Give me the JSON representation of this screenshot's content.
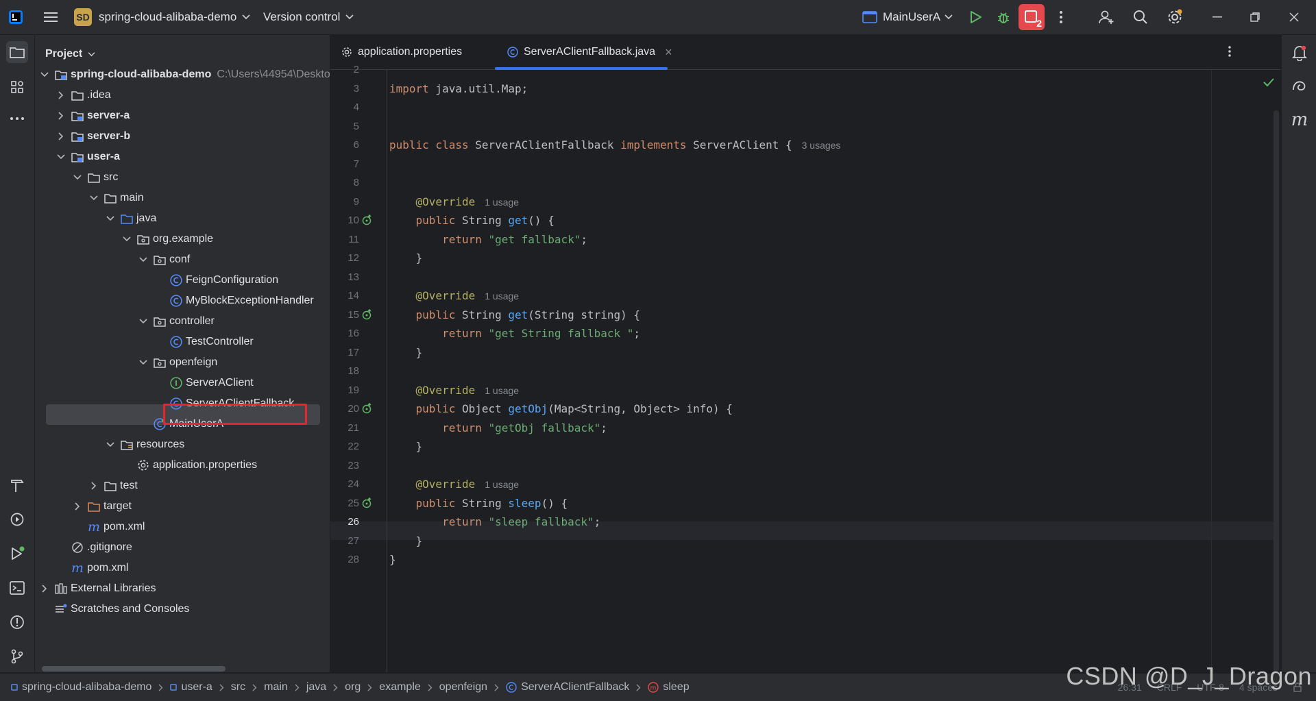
{
  "titlebar": {
    "project_badge": "SD",
    "project_name": "spring-cloud-alibaba-demo",
    "version_control": "Version control",
    "run_config": "MainUserA",
    "stop_badge": "2"
  },
  "project_panel": {
    "title": "Project",
    "root_path": "C:\\Users\\44954\\Deskto"
  },
  "tree": [
    {
      "label": "spring-cloud-alibaba-demo",
      "depth": 0,
      "arrow": "down",
      "icon": "module-folder",
      "bold": true
    },
    {
      "label": ".idea",
      "depth": 1,
      "arrow": "right",
      "icon": "folder"
    },
    {
      "label": "server-a",
      "depth": 1,
      "arrow": "right",
      "icon": "module-folder",
      "bold": true
    },
    {
      "label": "server-b",
      "depth": 1,
      "arrow": "right",
      "icon": "module-folder",
      "bold": true
    },
    {
      "label": "user-a",
      "depth": 1,
      "arrow": "down",
      "icon": "module-folder",
      "bold": true
    },
    {
      "label": "src",
      "depth": 2,
      "arrow": "down",
      "icon": "folder"
    },
    {
      "label": "main",
      "depth": 3,
      "arrow": "down",
      "icon": "folder"
    },
    {
      "label": "java",
      "depth": 4,
      "arrow": "down",
      "icon": "source-folder"
    },
    {
      "label": "org.example",
      "depth": 5,
      "arrow": "down",
      "icon": "package"
    },
    {
      "label": "conf",
      "depth": 6,
      "arrow": "down",
      "icon": "package"
    },
    {
      "label": "FeignConfiguration",
      "depth": 7,
      "arrow": "none",
      "icon": "class"
    },
    {
      "label": "MyBlockExceptionHandler",
      "depth": 7,
      "arrow": "none",
      "icon": "class"
    },
    {
      "label": "controller",
      "depth": 6,
      "arrow": "down",
      "icon": "package"
    },
    {
      "label": "TestController",
      "depth": 7,
      "arrow": "none",
      "icon": "class"
    },
    {
      "label": "openfeign",
      "depth": 6,
      "arrow": "down",
      "icon": "package"
    },
    {
      "label": "ServerAClient",
      "depth": 7,
      "arrow": "none",
      "icon": "interface"
    },
    {
      "label": "ServerAClientFallback",
      "depth": 7,
      "arrow": "none",
      "icon": "class"
    },
    {
      "label": "MainUserA",
      "depth": 6,
      "arrow": "none",
      "icon": "class-runnable"
    },
    {
      "label": "resources",
      "depth": 4,
      "arrow": "down",
      "icon": "resources-folder"
    },
    {
      "label": "application.properties",
      "depth": 5,
      "arrow": "none",
      "icon": "properties"
    },
    {
      "label": "test",
      "depth": 3,
      "arrow": "right",
      "icon": "folder"
    },
    {
      "label": "target",
      "depth": 2,
      "arrow": "right",
      "icon": "excluded-folder"
    },
    {
      "label": "pom.xml",
      "depth": 2,
      "arrow": "none",
      "icon": "maven"
    },
    {
      "label": ".gitignore",
      "depth": 1,
      "arrow": "none",
      "icon": "ignored"
    },
    {
      "label": "pom.xml",
      "depth": 1,
      "arrow": "none",
      "icon": "maven"
    },
    {
      "label": "External Libraries",
      "depth": 0,
      "arrow": "right",
      "icon": "libraries"
    },
    {
      "label": "Scratches and Consoles",
      "depth": 0,
      "arrow": "none",
      "icon": "scratches"
    }
  ],
  "tabs": [
    {
      "label": "application.properties",
      "icon": "gear-icon",
      "active": false
    },
    {
      "label": "ServerAClientFallback.java",
      "icon": "class-icon",
      "active": true,
      "close": "×"
    }
  ],
  "code_lines": [
    {
      "n": "2",
      "parts": []
    },
    {
      "n": "3",
      "parts": [
        {
          "t": "import",
          "c": "kw"
        },
        {
          "t": " java.util.Map;",
          "c": ""
        }
      ]
    },
    {
      "n": "4",
      "parts": []
    },
    {
      "n": "5",
      "parts": []
    },
    {
      "n": "6",
      "parts": [
        {
          "t": "public class",
          "c": "kw"
        },
        {
          "t": " ServerAClientFallback ",
          "c": ""
        },
        {
          "t": "implements",
          "c": "kw"
        },
        {
          "t": " ServerAClient {",
          "c": ""
        }
      ],
      "hint": "3 usages"
    },
    {
      "n": "7",
      "parts": []
    },
    {
      "n": "8",
      "parts": []
    },
    {
      "n": "9",
      "parts": [
        {
          "t": "    @Override",
          "c": "ann"
        }
      ],
      "hint": "1 usage"
    },
    {
      "n": "10",
      "parts": [
        {
          "t": "    public",
          "c": "kw"
        },
        {
          "t": " String ",
          "c": ""
        },
        {
          "t": "get",
          "c": "fn"
        },
        {
          "t": "() {",
          "c": ""
        }
      ],
      "gutter_icon": true
    },
    {
      "n": "11",
      "parts": [
        {
          "t": "        return",
          "c": "kw"
        },
        {
          "t": " ",
          "c": ""
        },
        {
          "t": "\"get fallback\"",
          "c": "str"
        },
        {
          "t": ";",
          "c": ""
        }
      ]
    },
    {
      "n": "12",
      "parts": [
        {
          "t": "    }",
          "c": ""
        }
      ]
    },
    {
      "n": "13",
      "parts": []
    },
    {
      "n": "14",
      "parts": [
        {
          "t": "    @Override",
          "c": "ann"
        }
      ],
      "hint": "1 usage"
    },
    {
      "n": "15",
      "parts": [
        {
          "t": "    public",
          "c": "kw"
        },
        {
          "t": " String ",
          "c": ""
        },
        {
          "t": "get",
          "c": "fn"
        },
        {
          "t": "(String string) {",
          "c": ""
        }
      ],
      "gutter_icon": true
    },
    {
      "n": "16",
      "parts": [
        {
          "t": "        return",
          "c": "kw"
        },
        {
          "t": " ",
          "c": ""
        },
        {
          "t": "\"get String fallback \"",
          "c": "str"
        },
        {
          "t": ";",
          "c": ""
        }
      ]
    },
    {
      "n": "17",
      "parts": [
        {
          "t": "    }",
          "c": ""
        }
      ]
    },
    {
      "n": "18",
      "parts": []
    },
    {
      "n": "19",
      "parts": [
        {
          "t": "    @Override",
          "c": "ann"
        }
      ],
      "hint": "1 usage"
    },
    {
      "n": "20",
      "parts": [
        {
          "t": "    public",
          "c": "kw"
        },
        {
          "t": " Object ",
          "c": ""
        },
        {
          "t": "getObj",
          "c": "fn"
        },
        {
          "t": "(Map<String, Object> info) {",
          "c": ""
        }
      ],
      "gutter_icon": true
    },
    {
      "n": "21",
      "parts": [
        {
          "t": "        return",
          "c": "kw"
        },
        {
          "t": " ",
          "c": ""
        },
        {
          "t": "\"getObj fallback\"",
          "c": "str"
        },
        {
          "t": ";",
          "c": ""
        }
      ]
    },
    {
      "n": "22",
      "parts": [
        {
          "t": "    }",
          "c": ""
        }
      ]
    },
    {
      "n": "23",
      "parts": []
    },
    {
      "n": "24",
      "parts": [
        {
          "t": "    @Override",
          "c": "ann"
        }
      ],
      "hint": "1 usage"
    },
    {
      "n": "25",
      "parts": [
        {
          "t": "    public",
          "c": "kw"
        },
        {
          "t": " String ",
          "c": ""
        },
        {
          "t": "sleep",
          "c": "fn"
        },
        {
          "t": "() {",
          "c": ""
        }
      ],
      "gutter_icon": true
    },
    {
      "n": "26",
      "parts": [
        {
          "t": "        return",
          "c": "kw"
        },
        {
          "t": " ",
          "c": ""
        },
        {
          "t": "\"sleep fallback\"",
          "c": "str"
        },
        {
          "t": ";",
          "c": ""
        }
      ],
      "current": true
    },
    {
      "n": "27",
      "parts": [
        {
          "t": "    }",
          "c": ""
        }
      ]
    },
    {
      "n": "28",
      "parts": [
        {
          "t": "}",
          "c": ""
        }
      ]
    }
  ],
  "breadcrumbs": [
    {
      "label": "spring-cloud-alibaba-demo",
      "icon": "module"
    },
    {
      "label": "user-a",
      "icon": "module"
    },
    {
      "label": "src"
    },
    {
      "label": "main"
    },
    {
      "label": "java"
    },
    {
      "label": "org"
    },
    {
      "label": "example"
    },
    {
      "label": "openfeign"
    },
    {
      "label": "ServerAClientFallback",
      "icon": "class"
    },
    {
      "label": "sleep",
      "icon": "method"
    }
  ],
  "status_right": {
    "position": "26:31",
    "line_sep": "CRLF",
    "encoding": "UTF-8",
    "indent": "4 spaces"
  },
  "watermark": "CSDN @D_J_Dragon",
  "colors": {
    "accent": "#3574f0",
    "selection_outline": "#e5262f",
    "stop_button": "#e5484d",
    "run_green": "#5fb865"
  }
}
